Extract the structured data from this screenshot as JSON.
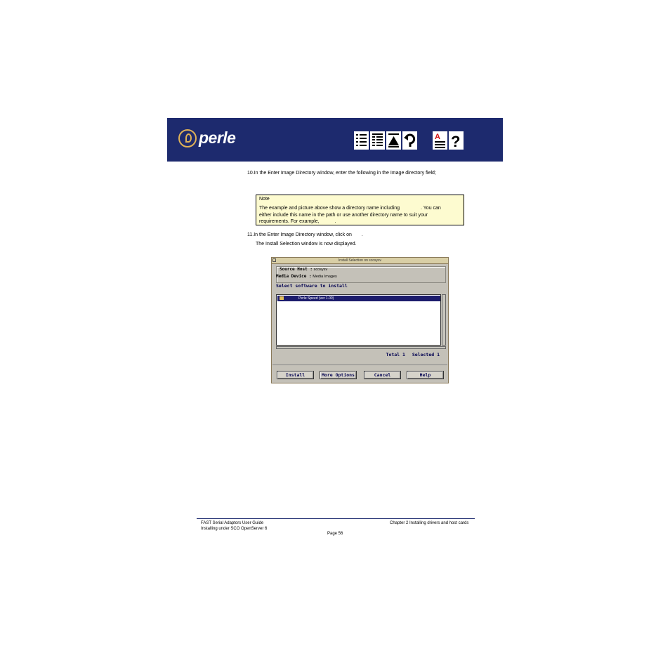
{
  "header": {
    "logo_text": "perle",
    "nav_icons": [
      "contents-icon",
      "index-icon",
      "top-icon",
      "back-icon",
      "glossary-icon",
      "help-icon"
    ]
  },
  "step10": {
    "text": "10.In the Enter Image Directory window, enter the following in the Image directory field;"
  },
  "note": {
    "title": "Note",
    "line1a": "The example and picture above show a directory name including",
    "line1b": ". You can",
    "line2": "either include this name in the path or use another directory name to suit your",
    "line3a": "requirements. For example,",
    "line3b": "."
  },
  "step11": {
    "text_a": "11.In the Enter Image Directory window, click on",
    "text_b": "."
  },
  "displayed_text": "The Install Selection window is now displayed.",
  "window": {
    "title": "Install Selection on scosysv",
    "source_host_label": "Source Host :",
    "source_host_value": "scosysv",
    "media_device_label": "Media Device :",
    "media_device_value": "Media Images",
    "select_label": "Select software to install",
    "list_items": [
      "Perle Speed (ver 1.00)"
    ],
    "total_label": "Total 1",
    "selected_label": "Selected 1",
    "buttons": {
      "install": "Install",
      "more": "More Options",
      "cancel": "Cancel",
      "help": "Help"
    }
  },
  "footer": {
    "guide": "FAST Serial Adaptors User Guide",
    "section": "Installing under SCO OpenServer 6",
    "chapter": "Chapter 2 Installing drivers and host cards",
    "page": "Page 56"
  }
}
